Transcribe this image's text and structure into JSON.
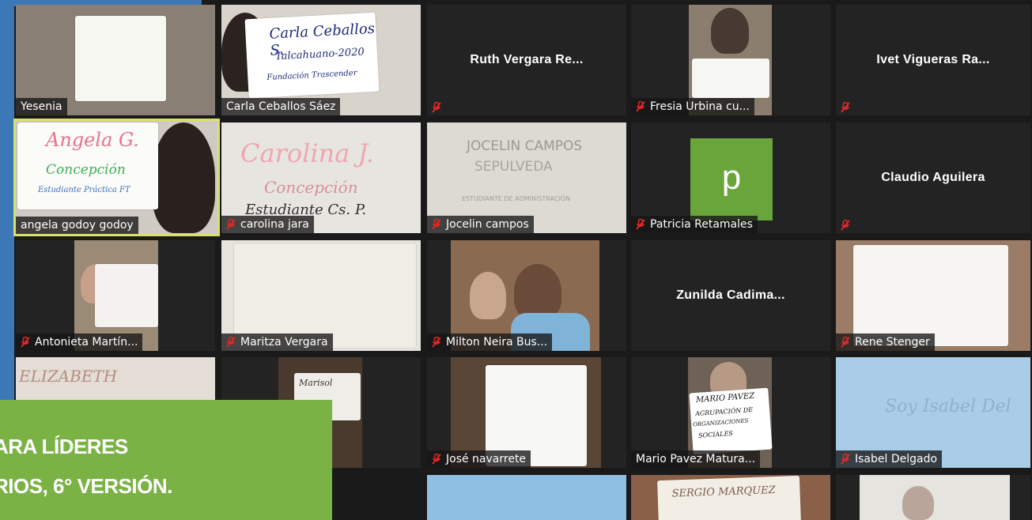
{
  "participants": [
    {
      "name": "Yesenia",
      "muted": false
    },
    {
      "name": "Carla Ceballos Sáez",
      "muted": false
    },
    {
      "name": "Ruth Vergara Re...",
      "muted": true,
      "video": false
    },
    {
      "name": "Fresia  Urbina cu...",
      "muted": true
    },
    {
      "name": "Ivet Vigueras Ra...",
      "muted": true,
      "video": false
    },
    {
      "name": "angela godoy godoy",
      "muted": false,
      "active": true
    },
    {
      "name": "carolina jara",
      "muted": true
    },
    {
      "name": "Jocelin campos",
      "muted": true
    },
    {
      "name": "Patricia Retamales",
      "muted": true,
      "avatar_letter": "p"
    },
    {
      "name": "Claudio Aguilera",
      "muted": true,
      "video": false
    },
    {
      "name": "Antonieta Martín...",
      "muted": true
    },
    {
      "name": "Maritza Vergara",
      "muted": true
    },
    {
      "name": "Milton Neira Bus...",
      "muted": true
    },
    {
      "name": "Zunilda  Cadima...",
      "muted": false,
      "video": false
    },
    {
      "name": "Rene Stenger",
      "muted": true
    },
    {
      "name": "José navarrete",
      "muted": true
    },
    {
      "name": "Mario Pavez Matura...",
      "muted": false
    },
    {
      "name": "Isabel Delgado",
      "muted": true
    }
  ],
  "signs": {
    "carla": [
      "Carla Ceballos S.",
      "Talcahuano-2020",
      "Fundación Trascender"
    ],
    "angela": [
      "Angela G.",
      "Concepción",
      "Estudiante Práctica FT"
    ],
    "carolina": [
      "Carolina J.",
      "Concepción",
      "Estudiante Cs. P."
    ],
    "jocelin": [
      "JOCELIN CAMPOS",
      "SEPULVEDA",
      "ESTUDIANTE DE ADMINISTRACIÓN"
    ],
    "elizabeth": "ELIZABETH",
    "mario": [
      "MARIO PAVEZ",
      "AGRUPACIÓN DE",
      "ORGANIZACIONES",
      "SOCIALES"
    ],
    "isabel": "Soy Isabel Del",
    "sergio": "SERGIO MARQUEZ",
    "marisol": "Marisol"
  },
  "banner": {
    "line1": "ARA LÍDERES",
    "line2": "RIOS, 6° VERSIÓN."
  },
  "colors": {
    "accent_blue": "#3b78b5",
    "banner_green": "#7ab245",
    "active_speaker": "#d9e06a",
    "mic_muted_red": "#e02828",
    "avatar_green": "#6aa53b"
  }
}
